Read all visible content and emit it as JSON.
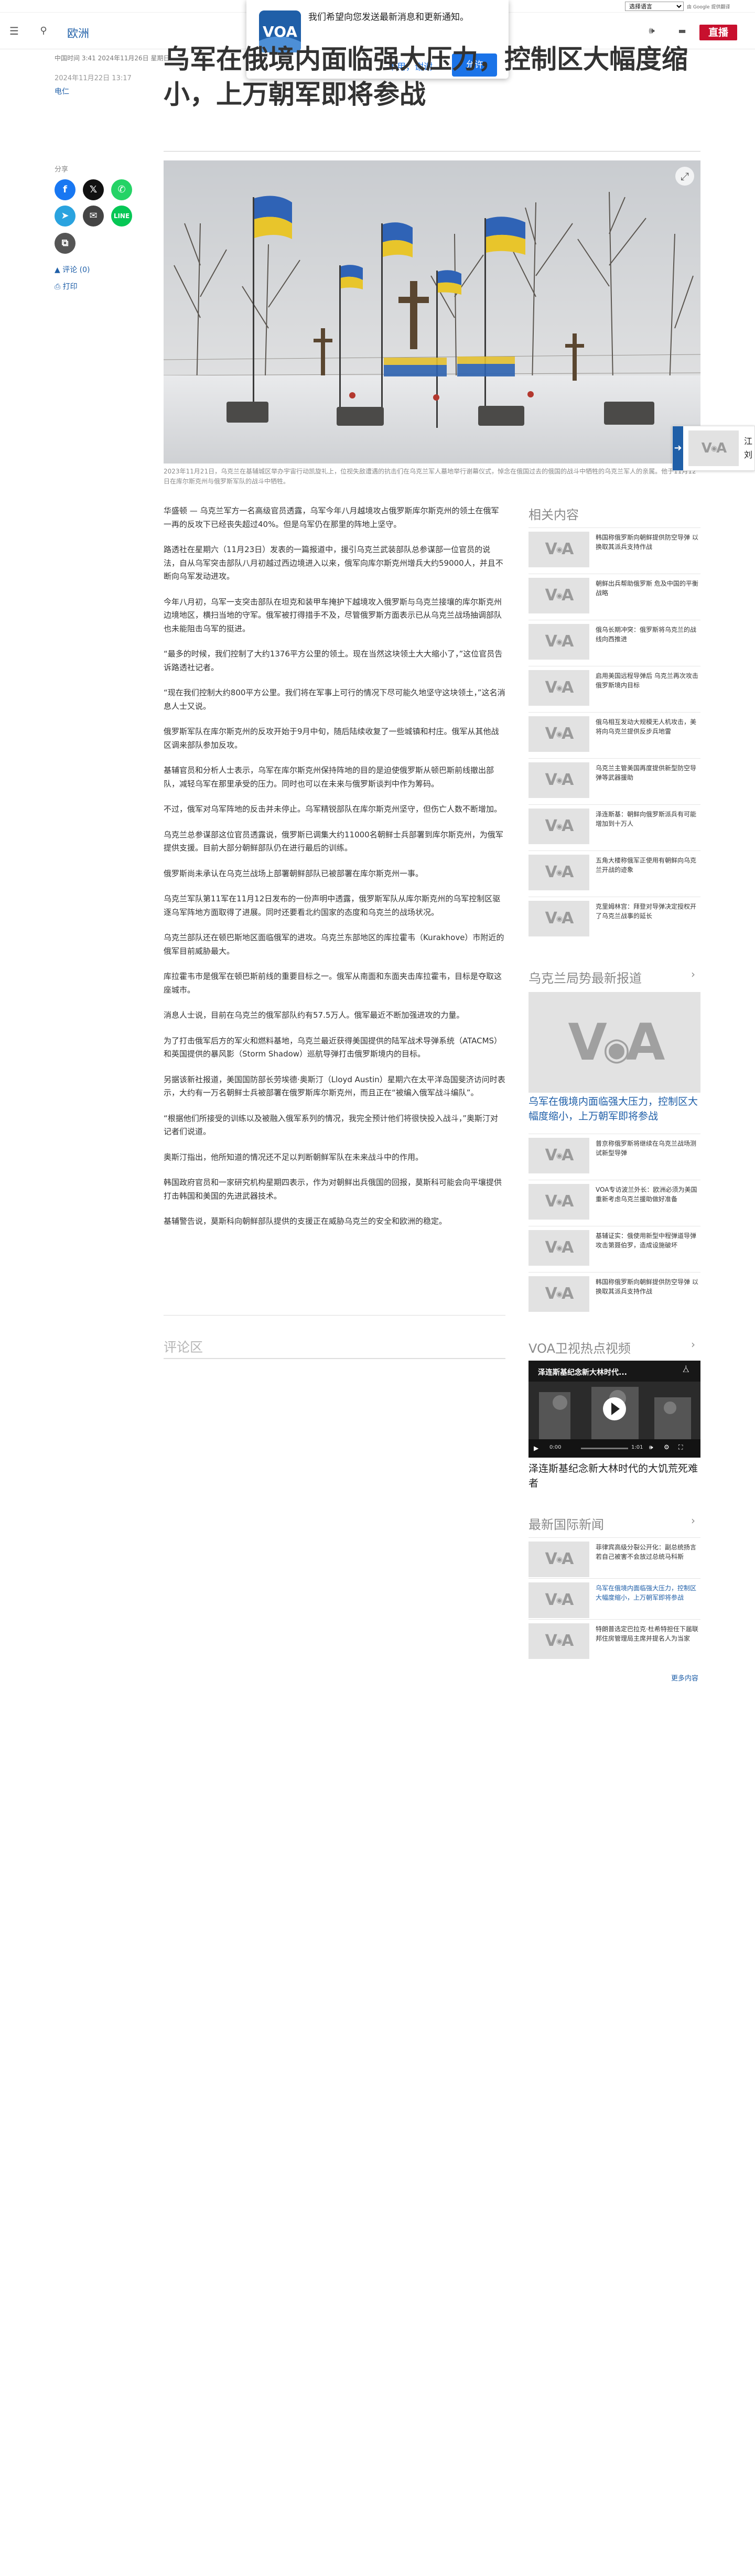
{
  "translate": {
    "select": "选择语言",
    "powered": "由 Google 提供翻译"
  },
  "nav": {
    "section": "欧洲",
    "live": "直播"
  },
  "popup": {
    "logo": "VOA",
    "text": "我们希望向您发送最新消息和更新通知。",
    "no": "不用，谢谢",
    "yes": "允许"
  },
  "meta": {
    "date_line": "中国时间 3:41 2024年11月26日 星期日",
    "published": "2024年11月22日 13:17",
    "author": "电仁"
  },
  "headline": "乌军在俄境内面临强大压力，控制区大幅度缩小，上万朝军即将参战",
  "share": {
    "label": "分享",
    "comments": "评论 (0)",
    "print": "打印"
  },
  "photo": {
    "caption": "2023年11月21日，乌克兰在基辅城区举办宇宙行动凯旋礼上，位视失敌遭遇的抗击们在乌克兰军人墓地举行谢幕仪式，悼念在俄国过去的俄国的战斗中牺牲的乌克兰军人的亲属。他于11月12日在库尔斯克州与俄罗斯军队的战斗中牺牲。",
    "expand_icon": "expand-icon"
  },
  "sidetab": {
    "text": "江\n刘"
  },
  "article": [
    "华盛顿 — 乌克兰军方一名高级官员透露，乌军今年八月越境攻占俄罗斯库尔斯克州的领土在俄军一再的反攻下已经丧失超过40%。但是乌军仍在那里的阵地上坚守。",
    "路透社在星期六（11月23日）发表的一篇报道中，援引乌克兰武装部队总参谋部一位官员的说法，自从乌军突击部队八月初越过西边境进入以来，俄军向库尔斯克州增兵大约59000人，并且不断向乌军发动进攻。",
    "今年八月初，乌军一支突击部队在坦克和装甲车掩护下越境攻入俄罗斯与乌克兰接壤的库尔斯克州边境地区，横扫当地的守军。俄军被打得措手不及，尽管俄罗斯方面表示已从乌克兰战场抽调部队也未能阻击乌军的挺进。",
    "“最多的时候，我们控制了大约1376平方公里的领土。现在当然这块领土大大缩小了，”这位官员告诉路透社记者。",
    "“现在我们控制大约800平方公里。我们将在军事上可行的情况下尽可能久地坚守这块领土，”这名消息人士又说。",
    "俄罗斯军队在库尔斯克州的反攻开始于9月中旬，随后陆续收复了一些城镇和村庄。俄军从其他战区调来部队参加反攻。",
    "基辅官员和分析人士表示，乌军在库尔斯克州保持阵地的目的是迫使俄罗斯从顿巴斯前线撤出部队，减轻乌军在那里承受的压力。同时也可以在未来与俄罗斯谈判中作为筹码。",
    "不过，俄军对乌军阵地的反击并未停止。乌军精锐部队在库尔斯克州坚守，但伤亡人数不断增加。",
    "乌克兰总参谋部这位官员透露说，俄罗斯已调集大约11000名朝鲜士兵部署到库尔斯克州，为俄军提供支援。目前大部分朝鲜部队仍在进行最后的训练。",
    "俄罗斯尚未承认在乌克兰战场上部署朝鲜部队已被部署在库尔斯克州一事。",
    "乌克兰军队第11军在11月12日发布的一份声明中透露，俄罗斯军队从库尔斯克州的乌军控制区驱逐乌军阵地方面取得了进展。同时还要看北约国家的态度和乌克兰的战场状况。",
    "乌克兰部队还在顿巴斯地区面临俄军的进攻。乌克兰东部地区的库拉霍韦（Kurakhove）市附近的俄军目前威胁最大。",
    "库拉霍韦市是俄军在顿巴斯前线的重要目标之一。俄军从南面和东面夹击库拉霍韦，目标是夺取这座城市。",
    "消息人士说，目前在乌克兰的俄军部队约有57.5万人。俄军最近不断加强进攻的力量。",
    "为了打击俄军后方的军火和燃料基地，乌克兰最近获得美国提供的陆军战术导弹系统（ATACMS）和英国提供的暴风影（Storm Shadow）巡航导弹打击俄罗斯境内的目标。",
    "另据该新社报道，美国国防部长劳埃德·奥斯汀（Lloyd Austin）星期六在太平洋岛国斐济访问时表示，大约有一万名朝鲜士兵被部署在俄罗斯库尔斯克州，而且正在“被编入俄军战斗编队”。",
    "“根据他们所接受的训练以及被融入俄军系列的情况，我完全预计他们将很快投入战斗，”奥斯汀对记者们说道。",
    "奥斯汀指出，他所知道的情况还不足以判断朝鲜军队在未来战斗中的作用。",
    "韩国政府官员和一家研究机构星期四表示，作为对朝鲜出兵俄国的回报，莫斯科可能会向平壤提供打击韩国和美国的先进武器技术。",
    "基辅警告说，莫斯科向朝鲜部队提供的支援正在威胁乌克兰的安全和欧洲的稳定。"
  ],
  "comments_label": "评论区",
  "related": {
    "heading": "相关内容",
    "items": [
      "韩国称俄罗斯向朝鲜提供防空导弹 以换取其派兵支持作战",
      "朝鲜出兵帮助俄罗斯 危及中国的平衡战略",
      "俄乌长期冲突：俄罗斯将乌克兰的战线向西推进",
      "启用美国远程导弹后 乌克兰再次攻击俄罗斯境内目标",
      "俄乌相互发动大规模无人机攻击，美将向乌克兰提供反步兵地雷",
      "乌克兰主管美国再度提供新型防空导弹等武器援助",
      "泽连斯基：朝鲜向俄罗斯派兵有可能增加到十万人",
      "五角大楼称俄军正使用有朝鲜向乌克兰开战的迹象",
      "克里姆林宫：拜登对导弹决定授权开了乌克兰战事的延长"
    ]
  },
  "ukraine": {
    "heading": "乌克兰局势最新报道",
    "feature_title": "乌军在俄境内面临强大压力，控制区大幅度缩小，上万朝军即将参战",
    "items": [
      "普京称俄罗斯将继续在乌克兰战场测试新型导弹",
      "VOA专访波兰外长：欧洲必须为美国重新考虑乌克兰援助做好准备",
      "基辅证实：俄使用新型中程弹道导弹攻击第聂伯罗，造成设施破坏",
      "韩国称俄罗斯向朝鲜提供防空导弹 以换取其派兵支持作战"
    ]
  },
  "video": {
    "heading": "VOA卫视热点视频",
    "overlay_title": "泽连斯基纪念新大林时代...",
    "title": "泽连斯基纪念新大林时代的大饥荒死难者",
    "time": "0:00",
    "duration": "1:01"
  },
  "intl": {
    "heading": "最新国际新闻",
    "items": [
      "菲律宾高级分裂公开化：副总统扬言若自己被害不会放过总统马科斯",
      "乌军在俄境内面临强大压力，控制区大幅度缩小，上万朝军即将参战",
      "特朗普选定巴拉克·杜希特担任下届联邦住房管理局主席并提名人为当家"
    ],
    "more": "更多内容"
  },
  "colors": {
    "brand_blue": "#1f5fa8",
    "live_red": "#c8102e",
    "button_blue": "#1a73e8"
  }
}
